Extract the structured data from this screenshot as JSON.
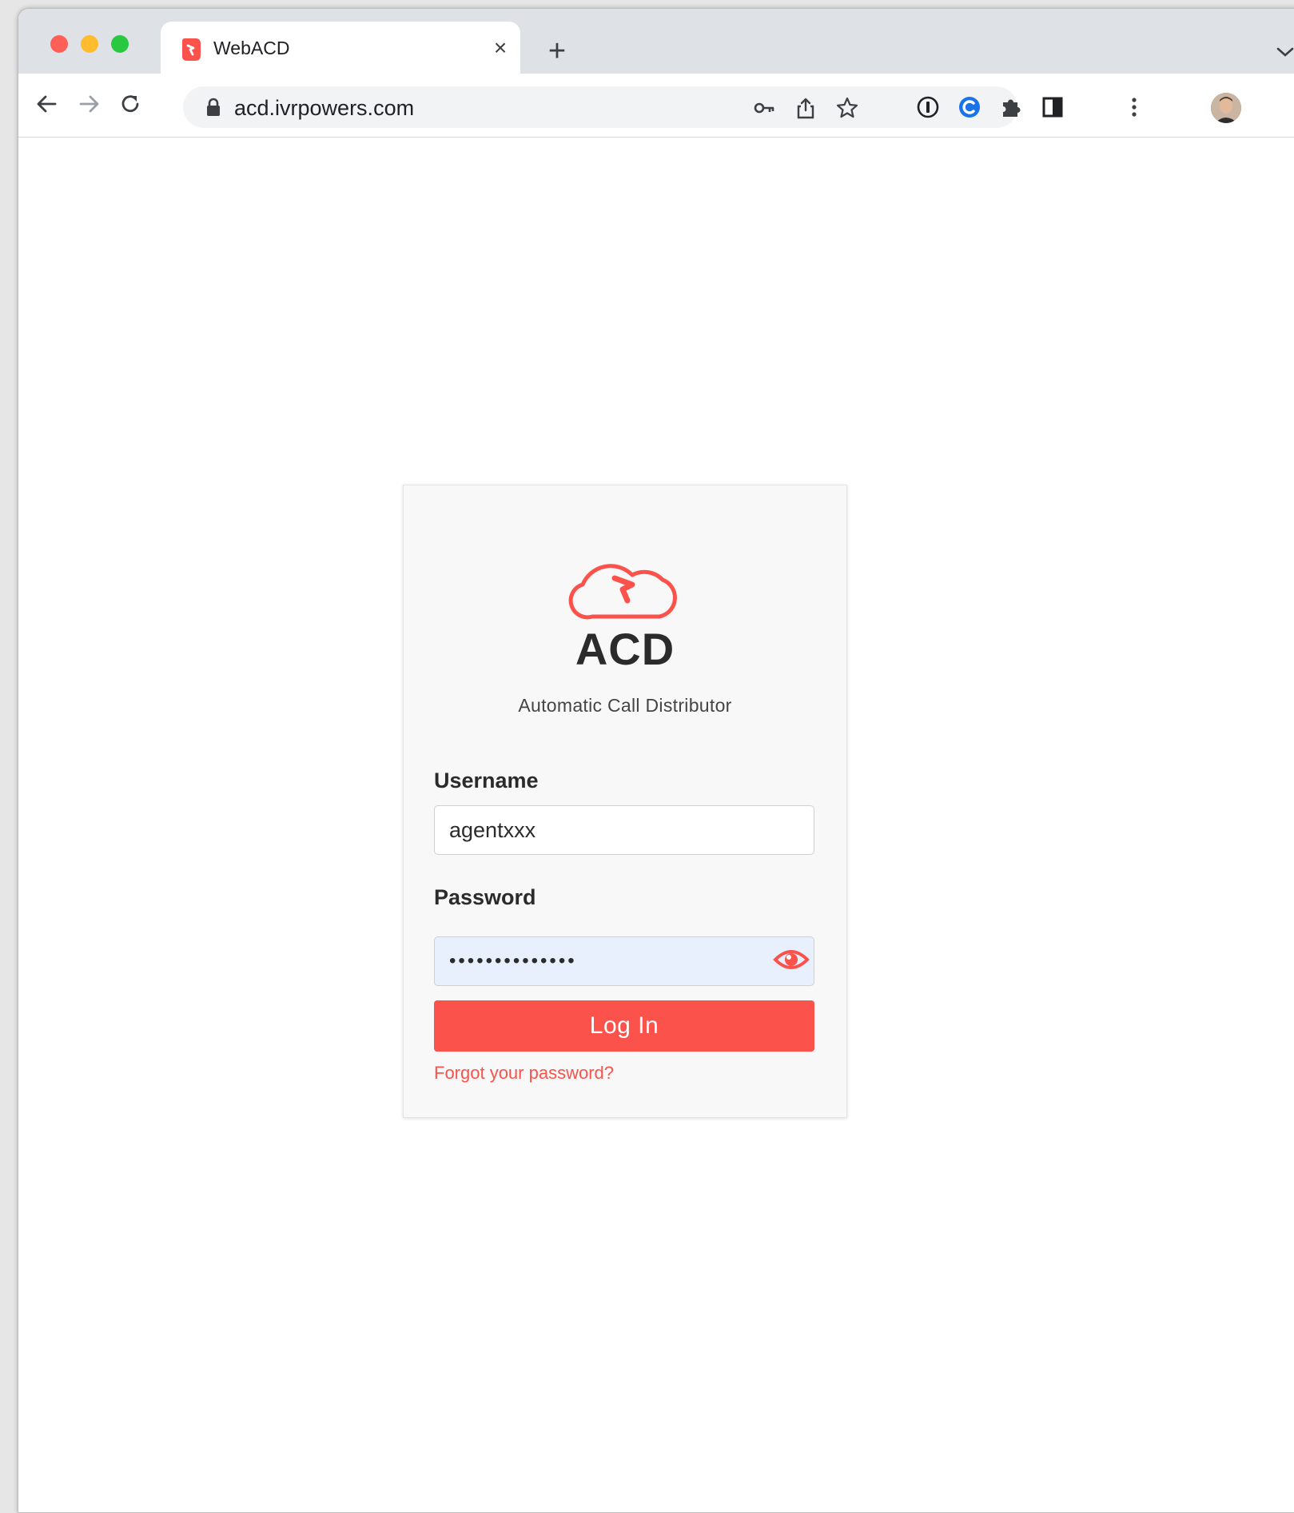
{
  "browser": {
    "tab": {
      "title": "WebACD",
      "close_glyph": "×"
    },
    "new_tab_glyph": "+",
    "address_bar": {
      "url": "acd.ivrpowers.com"
    },
    "icons": [
      "back-icon",
      "forward-icon",
      "reload-icon",
      "lock-icon",
      "key-icon",
      "share-icon",
      "star-icon",
      "password-manager-icon",
      "extension-icon",
      "puzzle-icon",
      "side-panel-icon",
      "avatar",
      "more-menu-icon",
      "chevron-down-icon"
    ]
  },
  "login": {
    "app_name": "ACD",
    "subtitle": "Automatic Call Distributor",
    "username_label": "Username",
    "username_value": "agentxxx",
    "password_label": "Password",
    "password_mask": "••••••••••••••",
    "login_label": "Log In",
    "forgot_label": "Forgot your password?"
  },
  "colors": {
    "accent": "#fb524b",
    "autofill_bg": "#e8f0fe",
    "tabstrip_bg": "#dee1e6"
  }
}
